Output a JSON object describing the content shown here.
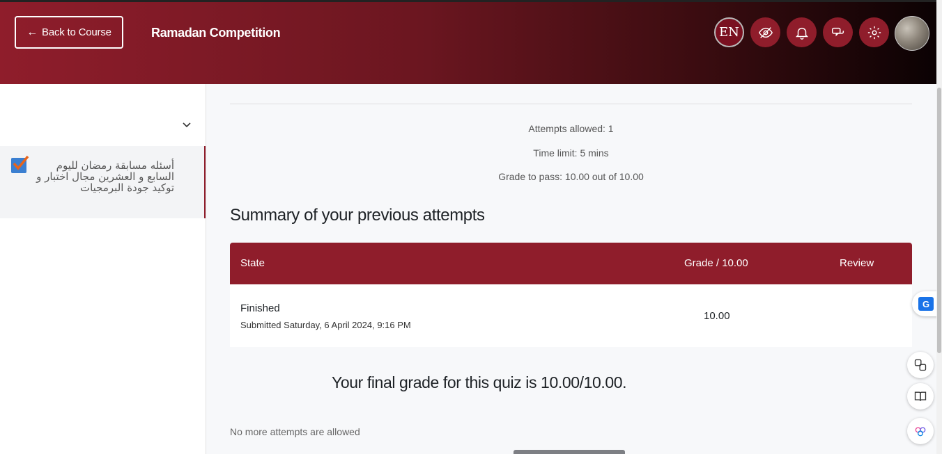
{
  "header": {
    "back_label": "Back to Course",
    "back_arrow": "←",
    "course_title": "Ramadan Competition",
    "lang_label": "EN",
    "icons": [
      "hide-eye-icon",
      "bell-icon",
      "chat-icon",
      "gear-icon"
    ]
  },
  "sidebar": {
    "item_label": "أسئله مسابقة رمضان لليوم السابع و العشرين مجال اختبار و توكيد جودة البرمجيات"
  },
  "main": {
    "attempts_allowed": "Attempts allowed: 1",
    "time_limit": "Time limit: 5 mins",
    "grade_to_pass": "Grade to pass: 10.00 out of 10.00",
    "summary_heading": "Summary of your previous attempts",
    "table": {
      "headers": [
        "State",
        "Grade / 10.00",
        "Review"
      ],
      "rows": [
        {
          "state": "Finished",
          "submitted": "Submitted Saturday, 6 April 2024, 9:16 PM",
          "grade": "10.00",
          "review": ""
        }
      ]
    },
    "final_grade": "Your final grade for this quiz is 10.00/10.00.",
    "no_more": "No more attempts are allowed"
  },
  "colors": {
    "brand": "#8f1d2b",
    "header_gradient_end": "#0b0203"
  }
}
